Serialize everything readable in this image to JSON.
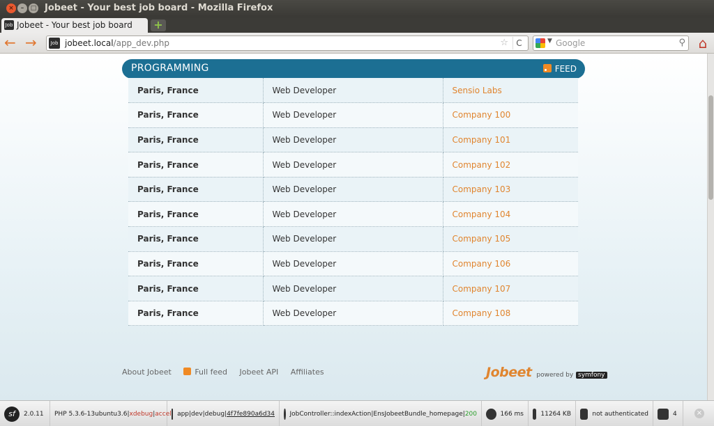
{
  "window": {
    "title": "Jobeet - Your best job board - Mozilla Firefox"
  },
  "tab": {
    "favicon": "Job",
    "label": "Jobeet - Your best job board",
    "new_tab": "+"
  },
  "nav": {
    "url_host": "jobeet.local",
    "url_path": "/app_dev.php",
    "search_placeholder": "Google",
    "back_icon": "←",
    "forward_icon": "→",
    "star_icon": "☆",
    "reload_icon": "C",
    "search_icon": "⚲",
    "home_icon": "⌂"
  },
  "category": {
    "title": "PROGRAMMING",
    "feed_label": "FEED"
  },
  "jobs": [
    {
      "location": "Paris, France",
      "position": "Web Developer",
      "company": "Sensio Labs"
    },
    {
      "location": "Paris, France",
      "position": "Web Developer",
      "company": "Company 100"
    },
    {
      "location": "Paris, France",
      "position": "Web Developer",
      "company": "Company 101"
    },
    {
      "location": "Paris, France",
      "position": "Web Developer",
      "company": "Company 102"
    },
    {
      "location": "Paris, France",
      "position": "Web Developer",
      "company": "Company 103"
    },
    {
      "location": "Paris, France",
      "position": "Web Developer",
      "company": "Company 104"
    },
    {
      "location": "Paris, France",
      "position": "Web Developer",
      "company": "Company 105"
    },
    {
      "location": "Paris, France",
      "position": "Web Developer",
      "company": "Company 106"
    },
    {
      "location": "Paris, France",
      "position": "Web Developer",
      "company": "Company 107"
    },
    {
      "location": "Paris, France",
      "position": "Web Developer",
      "company": "Company 108"
    }
  ],
  "footer": {
    "about": "About Jobeet",
    "full_feed": "Full feed",
    "api": "Jobeet API",
    "affiliates": "Affiliates",
    "brand_logo": "Jobeet",
    "powered_by": "powered by",
    "symfony": "symfony"
  },
  "toolbar": {
    "sf_version": "2.0.11",
    "php_version": "PHP 5.3.6-13ubuntu3.6",
    "xdebug": "xdebug",
    "accel": "accel",
    "env": "app|dev|debug|",
    "token": "4f7fe890a6d34",
    "controller": "JobController::indexAction|EnsJobeetBundle_homepage|",
    "status": "200",
    "time": "166 ms",
    "memory": "11264 KB",
    "user": "not authenticated",
    "queries": "4"
  },
  "colors": {
    "accent": "#1c6f93",
    "link": "#e0852f",
    "feed": "#f08a24"
  }
}
